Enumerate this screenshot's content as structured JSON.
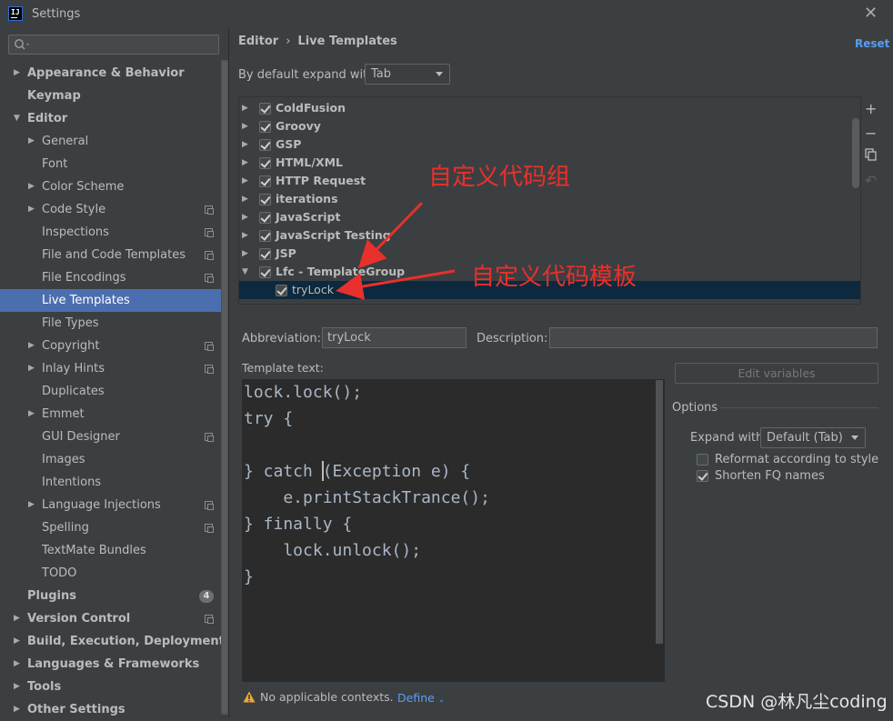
{
  "window": {
    "title": "Settings",
    "close_icon": "close-icon",
    "logo_text": "IJ"
  },
  "sidebar": {
    "search_placeholder": "",
    "items": [
      {
        "label": "Appearance & Behavior",
        "level": 0,
        "expander": "collapsed",
        "bold": true
      },
      {
        "label": "Keymap",
        "level": 0,
        "expander": "none",
        "bold": true
      },
      {
        "label": "Editor",
        "level": 0,
        "expander": "expanded",
        "bold": true
      },
      {
        "label": "General",
        "level": 1,
        "expander": "collapsed"
      },
      {
        "label": "Font",
        "level": 1,
        "expander": "none"
      },
      {
        "label": "Color Scheme",
        "level": 1,
        "expander": "collapsed"
      },
      {
        "label": "Code Style",
        "level": 1,
        "expander": "collapsed",
        "project_icon": true
      },
      {
        "label": "Inspections",
        "level": 1,
        "expander": "none",
        "project_icon": true
      },
      {
        "label": "File and Code Templates",
        "level": 1,
        "expander": "none",
        "project_icon": true
      },
      {
        "label": "File Encodings",
        "level": 1,
        "expander": "none",
        "project_icon": true
      },
      {
        "label": "Live Templates",
        "level": 1,
        "expander": "none",
        "selected": true
      },
      {
        "label": "File Types",
        "level": 1,
        "expander": "none"
      },
      {
        "label": "Copyright",
        "level": 1,
        "expander": "collapsed",
        "project_icon": true
      },
      {
        "label": "Inlay Hints",
        "level": 1,
        "expander": "collapsed",
        "project_icon": true
      },
      {
        "label": "Duplicates",
        "level": 1,
        "expander": "none"
      },
      {
        "label": "Emmet",
        "level": 1,
        "expander": "collapsed"
      },
      {
        "label": "GUI Designer",
        "level": 1,
        "expander": "none",
        "project_icon": true
      },
      {
        "label": "Images",
        "level": 1,
        "expander": "none"
      },
      {
        "label": "Intentions",
        "level": 1,
        "expander": "none"
      },
      {
        "label": "Language Injections",
        "level": 1,
        "expander": "collapsed",
        "project_icon": true
      },
      {
        "label": "Spelling",
        "level": 1,
        "expander": "none",
        "project_icon": true
      },
      {
        "label": "TextMate Bundles",
        "level": 1,
        "expander": "none"
      },
      {
        "label": "TODO",
        "level": 1,
        "expander": "none"
      },
      {
        "label": "Plugins",
        "level": 0,
        "expander": "none",
        "bold": true,
        "badge": "4"
      },
      {
        "label": "Version Control",
        "level": 0,
        "expander": "collapsed",
        "bold": true,
        "project_icon": true
      },
      {
        "label": "Build, Execution, Deployment",
        "level": 0,
        "expander": "collapsed",
        "bold": true
      },
      {
        "label": "Languages & Frameworks",
        "level": 0,
        "expander": "collapsed",
        "bold": true
      },
      {
        "label": "Tools",
        "level": 0,
        "expander": "collapsed",
        "bold": true
      },
      {
        "label": "Other Settings",
        "level": 0,
        "expander": "collapsed",
        "bold": true
      }
    ]
  },
  "header": {
    "breadcrumb": [
      "Editor",
      "Live Templates"
    ],
    "breadcrumb_sep": "›",
    "reset_label": "Reset"
  },
  "expand_default": {
    "label": "By default expand with",
    "value": "Tab"
  },
  "template_tree": {
    "rows": [
      {
        "label": "ColdFusion",
        "checked": true,
        "expander": "collapsed",
        "level": 0
      },
      {
        "label": "Groovy",
        "checked": true,
        "expander": "collapsed",
        "level": 0
      },
      {
        "label": "GSP",
        "checked": true,
        "expander": "collapsed",
        "level": 0
      },
      {
        "label": "HTML/XML",
        "checked": true,
        "expander": "collapsed",
        "level": 0
      },
      {
        "label": "HTTP Request",
        "checked": true,
        "expander": "collapsed",
        "level": 0
      },
      {
        "label": "iterations",
        "checked": true,
        "expander": "collapsed",
        "level": 0
      },
      {
        "label": "JavaScript",
        "checked": true,
        "expander": "collapsed",
        "level": 0
      },
      {
        "label": "JavaScript Testing",
        "checked": true,
        "expander": "collapsed",
        "level": 0
      },
      {
        "label": "JSP",
        "checked": true,
        "expander": "collapsed",
        "level": 0
      },
      {
        "label": "Lfc - TemplateGroup",
        "checked": true,
        "expander": "expanded",
        "level": 0
      },
      {
        "label": "tryLock",
        "checked": true,
        "expander": "none",
        "level": 1,
        "selected": true
      }
    ],
    "side_buttons": [
      {
        "name": "add-icon",
        "glyph": "+"
      },
      {
        "name": "remove-icon",
        "glyph": "−"
      },
      {
        "name": "copy-icon",
        "glyph": ""
      },
      {
        "name": "undo-icon",
        "glyph": "↶"
      }
    ]
  },
  "details": {
    "abbreviation_label": "Abbreviation:",
    "abbreviation_value": "tryLock",
    "description_label": "Description:",
    "description_value": "",
    "template_text_label": "Template text:",
    "edit_variables_label": "Edit variables"
  },
  "template_code": [
    "lock.lock();",
    "try {",
    "",
    "} catch (Exception e) {",
    "    e.printStackTrance();",
    "} finally {",
    "    lock.unlock();",
    "}"
  ],
  "options": {
    "title": "Options",
    "expand_with_label": "Expand with",
    "expand_with_value": "Default (Tab)",
    "reformat_label": "Reformat according to style",
    "reformat_checked": false,
    "shorten_fq_label": "Shorten FQ names",
    "shorten_fq_checked": true
  },
  "footer": {
    "warning_text": "No applicable contexts.",
    "define_label": "Define",
    "warning_icon": "warning-icon"
  },
  "annotations": {
    "group_note": "自定义代码组",
    "template_note": "自定义代码模板",
    "color": "#e8302c"
  },
  "watermark": "CSDN @林凡尘coding",
  "colors": {
    "background": "#3c3f41",
    "editor_bg": "#2b2b2b",
    "selection": "#4b6eaf",
    "tree_selection": "#0d293e",
    "link": "#589df6"
  }
}
